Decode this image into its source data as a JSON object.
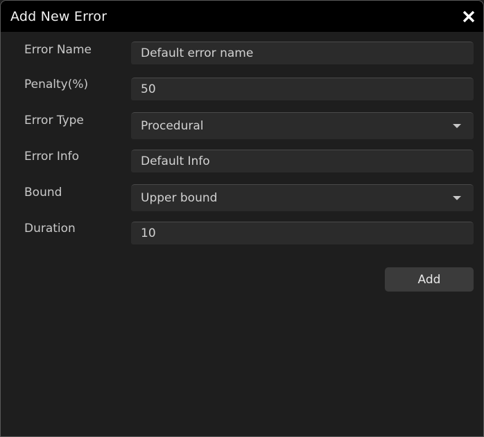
{
  "dialog": {
    "title": "Add New Error",
    "close_icon": "close-icon"
  },
  "form": {
    "fields": [
      {
        "label": "Error Name",
        "type": "text",
        "value": "Default error name",
        "name": "error-name"
      },
      {
        "label": "Penalty(%)",
        "type": "text",
        "value": "50",
        "name": "penalty-percent"
      },
      {
        "label": "Error Type",
        "type": "select",
        "value": "Procedural",
        "name": "error-type",
        "caret_icon": "chevron-down-icon"
      },
      {
        "label": "Error Info",
        "type": "text",
        "value": "Default Info",
        "name": "error-info"
      },
      {
        "label": "Bound",
        "type": "select",
        "value": "Upper bound",
        "name": "bound",
        "caret_icon": "chevron-down-icon"
      },
      {
        "label": "Duration",
        "type": "text",
        "value": "10",
        "name": "duration"
      }
    ]
  },
  "footer": {
    "add_label": "Add"
  },
  "colors": {
    "titlebar_background": "#000000",
    "dialog_background": "#1e1e1e",
    "field_background": "#2b2b2b",
    "field_top_border": "#4a4a4a",
    "button_background": "#3b3b3b",
    "label_text": "#c9c9c9",
    "value_text": "#d2d2d2",
    "title_text": "#f2f2f2",
    "dialog_border": "#5a5a5a"
  }
}
